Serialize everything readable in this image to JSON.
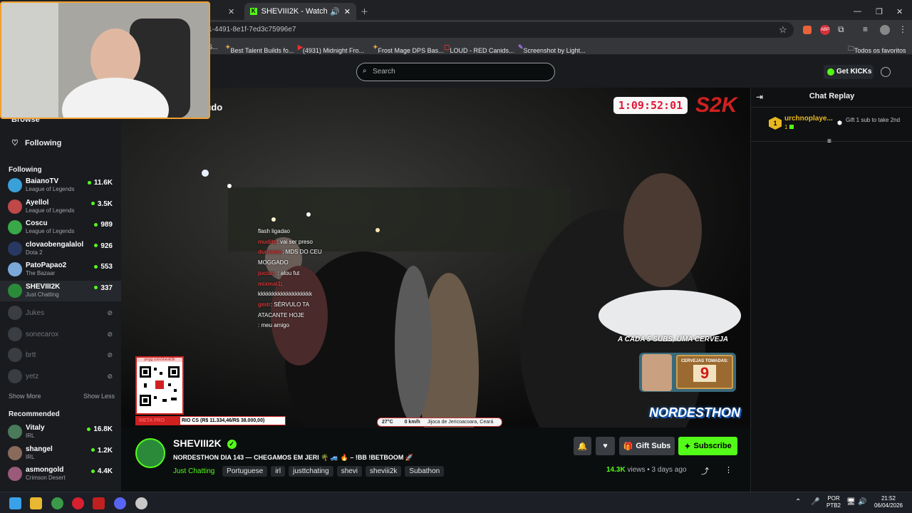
{
  "browser": {
    "tabs": [
      {
        "label": "SHEVIII2K - Watch the VOD"
      }
    ],
    "url": "1-4491-8e1f-7ed3c75996e7",
    "bookmarks": [
      "Best Talent Builds fo...",
      "(4931) Midnight Fro...",
      "Frost Mage DPS Bas...",
      "LOUD - RED Canids...",
      "Screenshot by Light..."
    ],
    "bookmark_prefix": "S...",
    "all_bookmarks": "Todos os favoritos"
  },
  "topbar": {
    "search_placeholder": "Search",
    "get_kicks": "Get KICKs"
  },
  "sidebar": {
    "browse": "Browse",
    "following_nav": "Following",
    "following_header": "Following",
    "following": [
      {
        "name": "BaianoTV",
        "game": "League of Legends",
        "viewers": "11.6K",
        "color": "#3aa0d8"
      },
      {
        "name": "Ayellol",
        "game": "League of Legends",
        "viewers": "3.5K",
        "color": "#c04848"
      },
      {
        "name": "Coscu",
        "game": "League of Legends",
        "viewers": "989",
        "color": "#38a848"
      },
      {
        "name": "clovaobengalalol",
        "game": "Dota 2",
        "viewers": "926",
        "color": "#283860"
      },
      {
        "name": "PatoPapao2",
        "game": "The Bazaar",
        "viewers": "553",
        "color": "#7aa8d8"
      },
      {
        "name": "SHEVIII2K",
        "game": "Just Chatting",
        "viewers": "337",
        "color": "#2a8a3a"
      }
    ],
    "offline": [
      "Jukes",
      "sonecarox",
      "brtt",
      "yetz"
    ],
    "show_more": "Show More",
    "show_less": "Show Less",
    "recommended_header": "Recommended",
    "recommended": [
      {
        "name": "Vitaly",
        "game": "IRL",
        "viewers": "16.8K",
        "color": "#4a7a5a"
      },
      {
        "name": "shangel",
        "game": "IRL",
        "viewers": "1.2K",
        "color": "#8a6a5a"
      },
      {
        "name": "asmongold",
        "game": "Crimson Desert",
        "viewers": "4.4K",
        "color": "#9a5a7a"
      }
    ]
  },
  "video": {
    "timer": "1:09:52:01",
    "logo": "S2K",
    "overlay_title_fragment": "tudo",
    "chat_overlay": [
      {
        "user": "",
        "text": "flash ligadao"
      },
      {
        "user": "mudito",
        "text": ": vai ser preso"
      },
      {
        "user": "dudumar",
        "text": ": MDS DO CEU"
      },
      {
        "user": "",
        "text": "MOGGADO"
      },
      {
        "user": "jucian_",
        "text": ": alou fut"
      },
      {
        "user": "mixmal1",
        "text": ":"
      },
      {
        "user": "",
        "text": "kkkkkkkkkkkkkkkkkkk"
      },
      {
        "user": "gmtr",
        "text": ": SÉRVULO TA"
      },
      {
        "user": "",
        "text": "ATACANTE HOJE"
      },
      {
        "user": "",
        "text": ": meu amigo"
      }
    ],
    "qr_url": "pixgg.com/sheviii2k",
    "goal_text": "RIO CS (R$ 11.334,46/R$ 38.000,00)",
    "goal_prefix": "META PRO",
    "weather": {
      "temp": "27°C",
      "wind": "0 km/h",
      "location": "Jijoca de Jericoacoara, Ceará"
    },
    "beer_banner": "A CADA 5 SUBS, UMA CERVEJA",
    "beer_label": "CERVEJAS TOMADAS:",
    "beer_count": "9",
    "nordesthon": "NORDESTHON"
  },
  "chat": {
    "title": "Chat Replay",
    "top_user": "urchnoplaye...",
    "top_amount": "1",
    "rank": "1",
    "gift_text": "Gift 1 sub to take 2nd"
  },
  "channel": {
    "name": "SHEVIII2K",
    "title": "NORDESTHON DIA 143 — CHEGAMOS EM JERI 🌴 🚙 🔥 – !BB !BETBOOM 🚀",
    "category": "Just Chatting",
    "tags": [
      "Portuguese",
      "irl",
      "justtchating",
      "shevi",
      "sheviii2k",
      "Subathon"
    ],
    "views": "14.3K",
    "views_label": "views",
    "ago": "3 days ago",
    "gift_subs": "Gift Subs",
    "subscribe": "Subscribe"
  },
  "taskbar": {
    "lang": "POR",
    "layout": "PTB2",
    "time": "21:52",
    "date": "06/04/2026"
  },
  "colors": {
    "kick_green": "#53fc18",
    "accent": "#f0a030"
  }
}
